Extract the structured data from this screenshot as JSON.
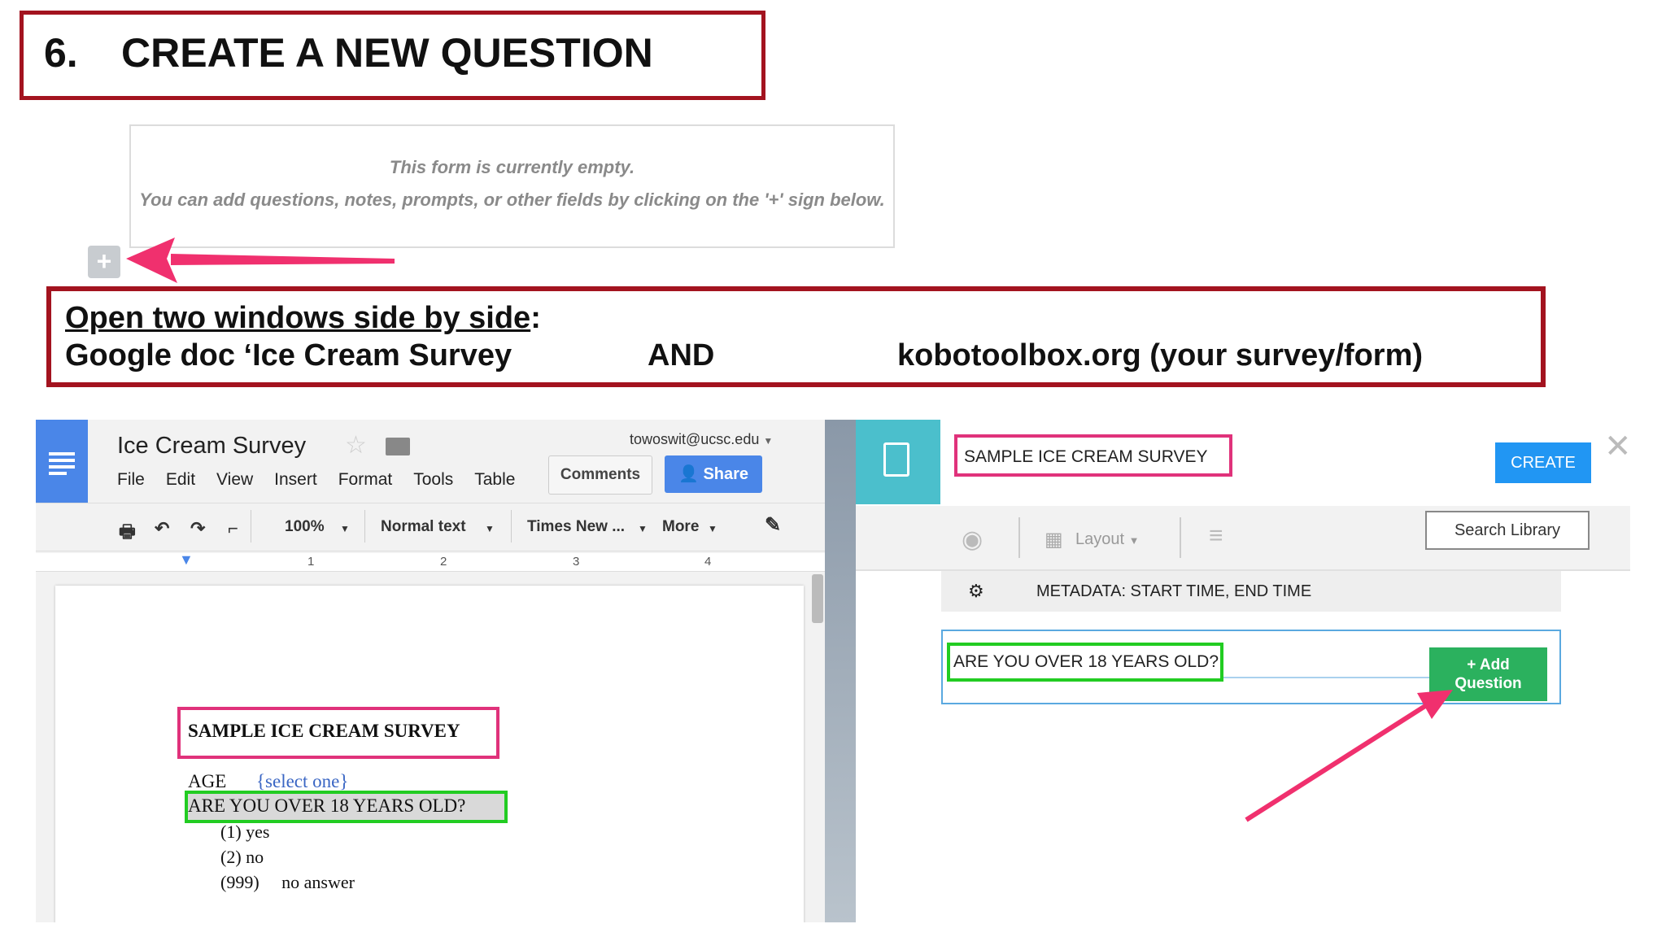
{
  "slide": {
    "title_number": "6.",
    "title_text": "CREATE A NEW QUESTION"
  },
  "empty_form": {
    "line1": "This form is currently empty.",
    "line2": "You can add questions, notes, prompts, or other fields by clicking on the '+' sign below.",
    "add_icon": "+"
  },
  "instructions": {
    "line1_underlined": "Open two windows side by side",
    "line1_suffix": ":",
    "line2_left": "Google doc ‘Ice Cream Survey",
    "line2_and": "AND",
    "line2_right": "kobotoolbox.org (your survey/form)"
  },
  "gdoc": {
    "title": "Ice Cream Survey",
    "email": "towoswit@ucsc.edu",
    "menu": [
      "File",
      "Edit",
      "View",
      "Insert",
      "Format",
      "Tools",
      "Table"
    ],
    "comments_label": "Comments",
    "share_label": "Share",
    "toolbar": {
      "zoom": "100%",
      "style": "Normal text",
      "font": "Times New ...",
      "more": "More"
    },
    "ruler_ticks": [
      "1",
      "2",
      "3",
      "4"
    ],
    "content": {
      "heading": "SAMPLE ICE CREAM SURVEY",
      "age_label": "AGE",
      "select_hint": "{select one}",
      "question": "ARE YOU OVER 18 YEARS OLD?",
      "options": [
        "(1)   yes",
        "(2)  no",
        "(999)     no answer"
      ]
    }
  },
  "kobo": {
    "form_title": "SAMPLE ICE CREAM SURVEY",
    "create_label": "CREATE",
    "close_icon": "✕",
    "layout_label": "Layout",
    "search_library_label": "Search Library",
    "metadata_text": "METADATA:  START TIME, END TIME",
    "question_text": "ARE YOU OVER 18 YEARS OLD?",
    "add_question_line1": "+ Add",
    "add_question_line2": "Question"
  },
  "colors": {
    "title_border": "#a3131f",
    "highlight_pink": "#e0327b",
    "highlight_green": "#22cc22",
    "arrow": "#f0306e",
    "kobo_teal": "#4bbfcc",
    "kobo_blue": "#2196f3",
    "kobo_green": "#2bb15e",
    "gdocs_blue": "#4a86e8"
  }
}
